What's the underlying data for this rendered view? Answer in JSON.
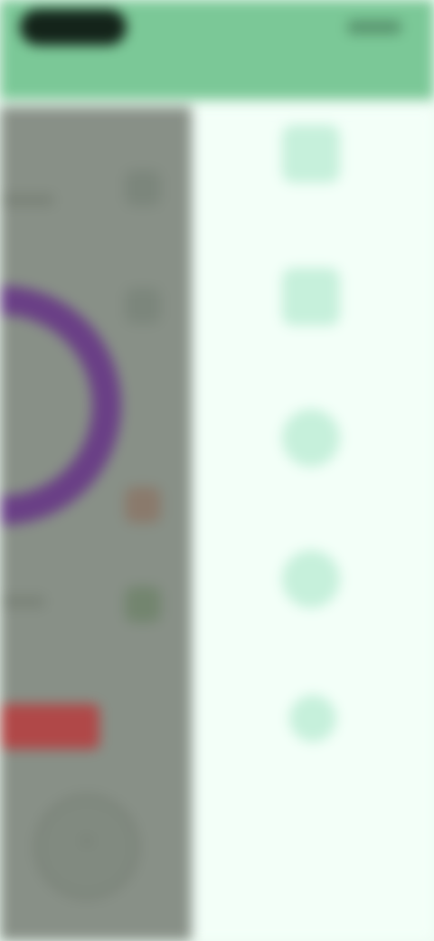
{
  "status_bar": {
    "label": ""
  },
  "main": {
    "ring_color": "#6a3f86",
    "alert_color": "#b04848"
  },
  "drawer": {
    "items": [
      {
        "label": "",
        "icon": "document-icon"
      },
      {
        "label": "",
        "icon": "calendar-icon"
      },
      {
        "label": "",
        "icon": "circle-icon"
      },
      {
        "label": "",
        "icon": "circle-icon"
      },
      {
        "label": "",
        "icon": "leaf-icon"
      }
    ]
  },
  "colors": {
    "header": "#7bc897",
    "drawer_bg": "#f3fff8",
    "drawer_icon": "#c6f0db",
    "scrim": "#889087"
  }
}
